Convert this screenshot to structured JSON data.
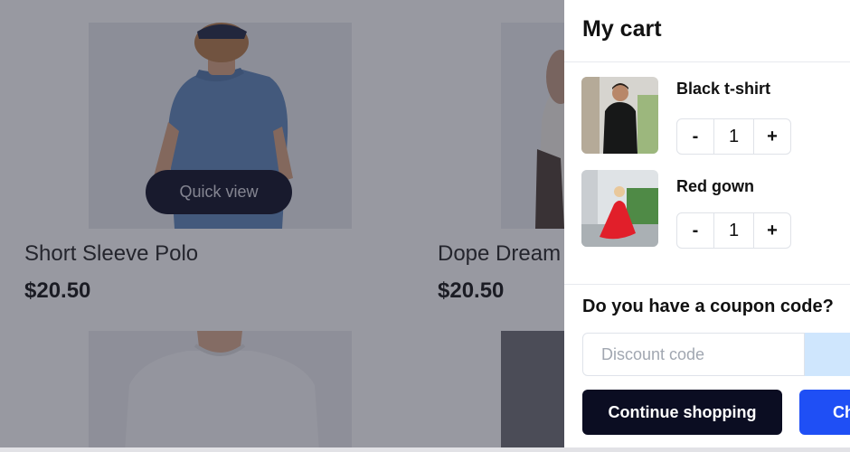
{
  "products": [
    {
      "name": "Short Sleeve Polo",
      "price": "$20.50"
    },
    {
      "name": "Dope Dream",
      "price": "$20.50"
    }
  ],
  "quick_view_label": "Quick view",
  "cart": {
    "title": "My cart",
    "items": [
      {
        "name": "Black t-shirt",
        "quantity": "1"
      },
      {
        "name": "Red gown",
        "quantity": "1"
      }
    ],
    "minus_label": "-",
    "plus_label": "+",
    "coupon_title": "Do you have a coupon code?",
    "discount_placeholder": "Discount code",
    "continue_label": "Continue shopping",
    "checkout_label": "Ch"
  },
  "colors": {
    "overlay": "#282a3a",
    "primary_dark": "#0b0d22",
    "accent_blue": "#1f4ff5"
  }
}
